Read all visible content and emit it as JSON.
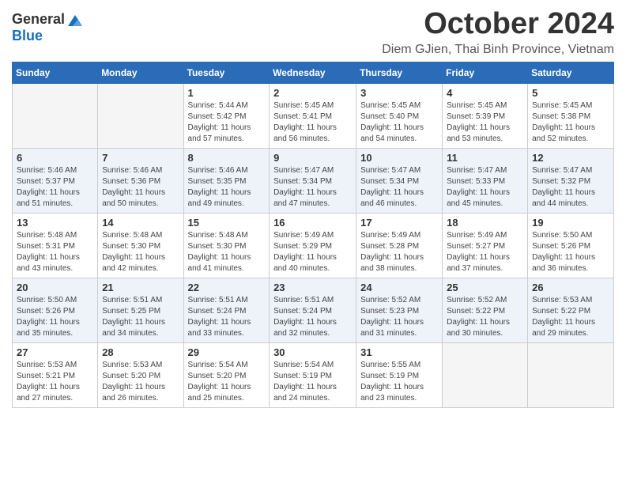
{
  "logo": {
    "general": "General",
    "blue": "Blue"
  },
  "header": {
    "title": "October 2024",
    "subtitle": "Diem GJien, Thai Binh Province, Vietnam"
  },
  "days_of_week": [
    "Sunday",
    "Monday",
    "Tuesday",
    "Wednesday",
    "Thursday",
    "Friday",
    "Saturday"
  ],
  "weeks": [
    {
      "days": [
        {
          "num": "",
          "empty": true
        },
        {
          "num": "",
          "empty": true
        },
        {
          "num": "1",
          "sunrise": "Sunrise: 5:44 AM",
          "sunset": "Sunset: 5:42 PM",
          "daylight": "Daylight: 11 hours and 57 minutes."
        },
        {
          "num": "2",
          "sunrise": "Sunrise: 5:45 AM",
          "sunset": "Sunset: 5:41 PM",
          "daylight": "Daylight: 11 hours and 56 minutes."
        },
        {
          "num": "3",
          "sunrise": "Sunrise: 5:45 AM",
          "sunset": "Sunset: 5:40 PM",
          "daylight": "Daylight: 11 hours and 54 minutes."
        },
        {
          "num": "4",
          "sunrise": "Sunrise: 5:45 AM",
          "sunset": "Sunset: 5:39 PM",
          "daylight": "Daylight: 11 hours and 53 minutes."
        },
        {
          "num": "5",
          "sunrise": "Sunrise: 5:45 AM",
          "sunset": "Sunset: 5:38 PM",
          "daylight": "Daylight: 11 hours and 52 minutes."
        }
      ]
    },
    {
      "days": [
        {
          "num": "6",
          "sunrise": "Sunrise: 5:46 AM",
          "sunset": "Sunset: 5:37 PM",
          "daylight": "Daylight: 11 hours and 51 minutes."
        },
        {
          "num": "7",
          "sunrise": "Sunrise: 5:46 AM",
          "sunset": "Sunset: 5:36 PM",
          "daylight": "Daylight: 11 hours and 50 minutes."
        },
        {
          "num": "8",
          "sunrise": "Sunrise: 5:46 AM",
          "sunset": "Sunset: 5:35 PM",
          "daylight": "Daylight: 11 hours and 49 minutes."
        },
        {
          "num": "9",
          "sunrise": "Sunrise: 5:47 AM",
          "sunset": "Sunset: 5:34 PM",
          "daylight": "Daylight: 11 hours and 47 minutes."
        },
        {
          "num": "10",
          "sunrise": "Sunrise: 5:47 AM",
          "sunset": "Sunset: 5:34 PM",
          "daylight": "Daylight: 11 hours and 46 minutes."
        },
        {
          "num": "11",
          "sunrise": "Sunrise: 5:47 AM",
          "sunset": "Sunset: 5:33 PM",
          "daylight": "Daylight: 11 hours and 45 minutes."
        },
        {
          "num": "12",
          "sunrise": "Sunrise: 5:47 AM",
          "sunset": "Sunset: 5:32 PM",
          "daylight": "Daylight: 11 hours and 44 minutes."
        }
      ]
    },
    {
      "days": [
        {
          "num": "13",
          "sunrise": "Sunrise: 5:48 AM",
          "sunset": "Sunset: 5:31 PM",
          "daylight": "Daylight: 11 hours and 43 minutes."
        },
        {
          "num": "14",
          "sunrise": "Sunrise: 5:48 AM",
          "sunset": "Sunset: 5:30 PM",
          "daylight": "Daylight: 11 hours and 42 minutes."
        },
        {
          "num": "15",
          "sunrise": "Sunrise: 5:48 AM",
          "sunset": "Sunset: 5:30 PM",
          "daylight": "Daylight: 11 hours and 41 minutes."
        },
        {
          "num": "16",
          "sunrise": "Sunrise: 5:49 AM",
          "sunset": "Sunset: 5:29 PM",
          "daylight": "Daylight: 11 hours and 40 minutes."
        },
        {
          "num": "17",
          "sunrise": "Sunrise: 5:49 AM",
          "sunset": "Sunset: 5:28 PM",
          "daylight": "Daylight: 11 hours and 38 minutes."
        },
        {
          "num": "18",
          "sunrise": "Sunrise: 5:49 AM",
          "sunset": "Sunset: 5:27 PM",
          "daylight": "Daylight: 11 hours and 37 minutes."
        },
        {
          "num": "19",
          "sunrise": "Sunrise: 5:50 AM",
          "sunset": "Sunset: 5:26 PM",
          "daylight": "Daylight: 11 hours and 36 minutes."
        }
      ]
    },
    {
      "days": [
        {
          "num": "20",
          "sunrise": "Sunrise: 5:50 AM",
          "sunset": "Sunset: 5:26 PM",
          "daylight": "Daylight: 11 hours and 35 minutes."
        },
        {
          "num": "21",
          "sunrise": "Sunrise: 5:51 AM",
          "sunset": "Sunset: 5:25 PM",
          "daylight": "Daylight: 11 hours and 34 minutes."
        },
        {
          "num": "22",
          "sunrise": "Sunrise: 5:51 AM",
          "sunset": "Sunset: 5:24 PM",
          "daylight": "Daylight: 11 hours and 33 minutes."
        },
        {
          "num": "23",
          "sunrise": "Sunrise: 5:51 AM",
          "sunset": "Sunset: 5:24 PM",
          "daylight": "Daylight: 11 hours and 32 minutes."
        },
        {
          "num": "24",
          "sunrise": "Sunrise: 5:52 AM",
          "sunset": "Sunset: 5:23 PM",
          "daylight": "Daylight: 11 hours and 31 minutes."
        },
        {
          "num": "25",
          "sunrise": "Sunrise: 5:52 AM",
          "sunset": "Sunset: 5:22 PM",
          "daylight": "Daylight: 11 hours and 30 minutes."
        },
        {
          "num": "26",
          "sunrise": "Sunrise: 5:53 AM",
          "sunset": "Sunset: 5:22 PM",
          "daylight": "Daylight: 11 hours and 29 minutes."
        }
      ]
    },
    {
      "days": [
        {
          "num": "27",
          "sunrise": "Sunrise: 5:53 AM",
          "sunset": "Sunset: 5:21 PM",
          "daylight": "Daylight: 11 hours and 27 minutes."
        },
        {
          "num": "28",
          "sunrise": "Sunrise: 5:53 AM",
          "sunset": "Sunset: 5:20 PM",
          "daylight": "Daylight: 11 hours and 26 minutes."
        },
        {
          "num": "29",
          "sunrise": "Sunrise: 5:54 AM",
          "sunset": "Sunset: 5:20 PM",
          "daylight": "Daylight: 11 hours and 25 minutes."
        },
        {
          "num": "30",
          "sunrise": "Sunrise: 5:54 AM",
          "sunset": "Sunset: 5:19 PM",
          "daylight": "Daylight: 11 hours and 24 minutes."
        },
        {
          "num": "31",
          "sunrise": "Sunrise: 5:55 AM",
          "sunset": "Sunset: 5:19 PM",
          "daylight": "Daylight: 11 hours and 23 minutes."
        },
        {
          "num": "",
          "empty": true
        },
        {
          "num": "",
          "empty": true
        }
      ]
    }
  ]
}
